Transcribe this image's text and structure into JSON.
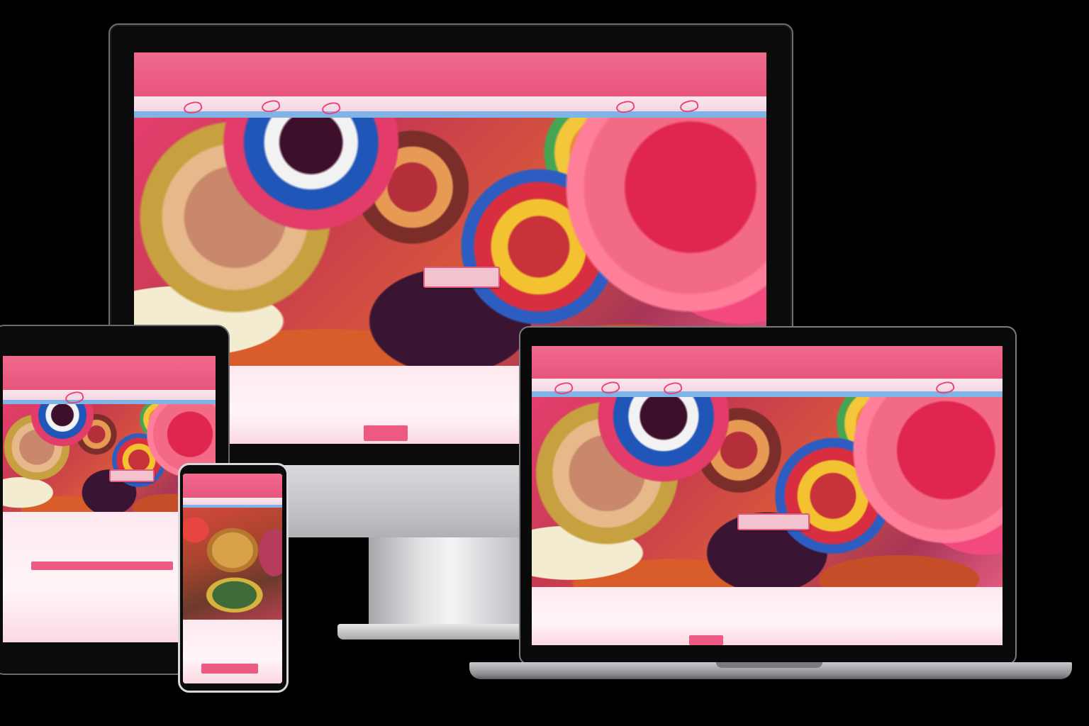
{
  "site": {
    "brand": "",
    "nav_center": "",
    "nav_right": "",
    "hero_title": "",
    "hero_button": "",
    "section_title": "",
    "section_subtitle": "",
    "second_title": ""
  },
  "colors": {
    "navbar_pink": "#e8557d",
    "accent_pink": "#ec5a83",
    "strip_blue": "#7fb4e6",
    "background": "#000000"
  }
}
